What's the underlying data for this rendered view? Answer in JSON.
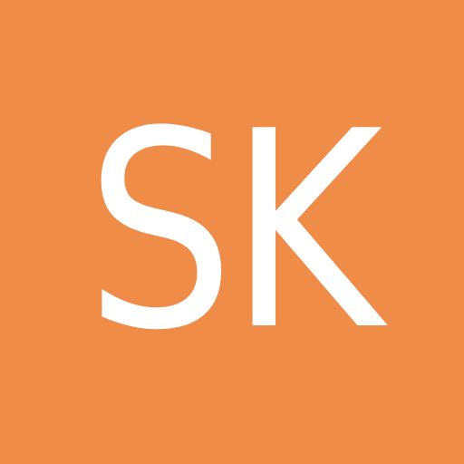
{
  "avatar": {
    "initials": "SK",
    "background_color": "#ee8c48",
    "text_color": "#ffffff"
  }
}
